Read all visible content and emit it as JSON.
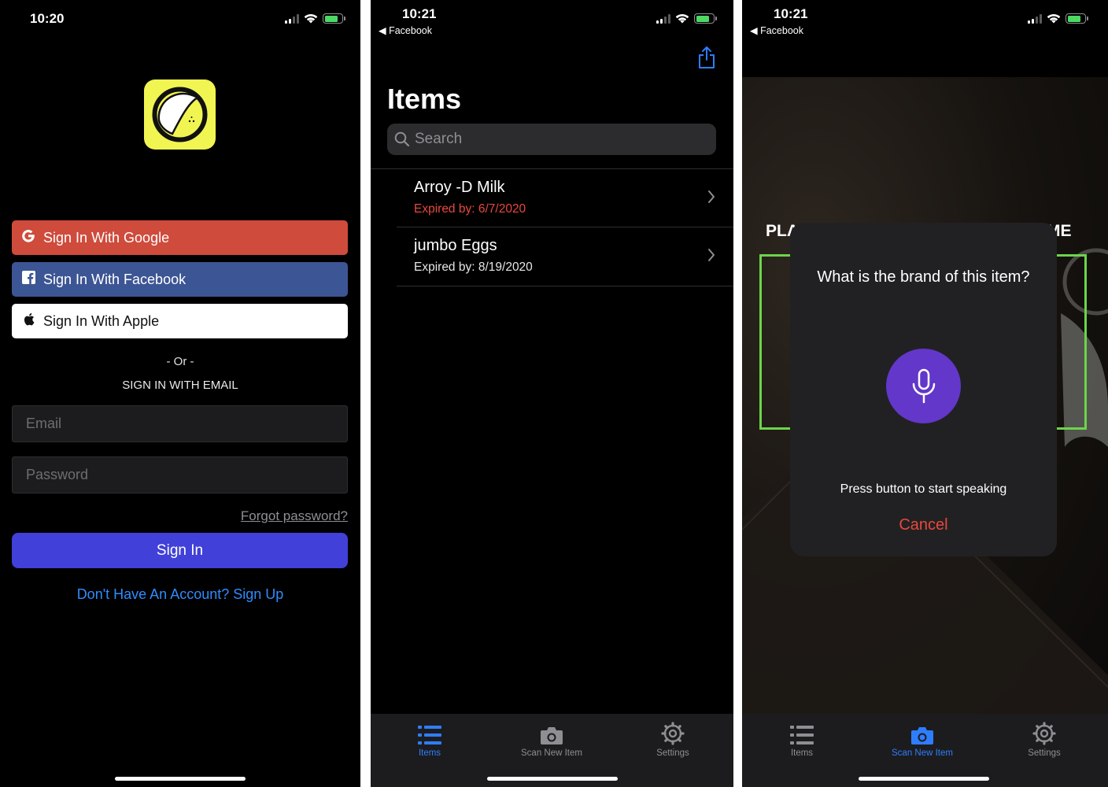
{
  "screen1": {
    "status_time": "10:20",
    "google_label": "Sign In With Google",
    "facebook_label": "Sign In With Facebook",
    "apple_label": "Sign In With Apple",
    "or_text": "- Or -",
    "email_heading": "SIGN IN WITH EMAIL",
    "email_placeholder": "Email",
    "password_placeholder": "Password",
    "forgot_label": "Forgot password?",
    "signin_label": "Sign In",
    "signup_label": "Don't Have An Account? Sign Up"
  },
  "screen2": {
    "status_time": "10:21",
    "back_label": "◀ Facebook",
    "title": "Items",
    "search_placeholder": "Search",
    "items": [
      {
        "name": "Arroy -D Milk",
        "expiry": "Expired by: 6/7/2020",
        "expired_color": "#e8483c"
      },
      {
        "name": "jumbo Eggs",
        "expiry": "Expired by: 8/19/2020",
        "expired_color": "#e6e6e6"
      }
    ],
    "tabs": [
      {
        "label": "Items",
        "icon": "list-icon"
      },
      {
        "label": "Scan New Item",
        "icon": "camera-icon"
      },
      {
        "label": "Settings",
        "icon": "gear-icon"
      }
    ],
    "active_tab": "Items"
  },
  "screen3": {
    "status_time": "10:21",
    "back_label": "◀ Facebook",
    "overlay_left": "PLA",
    "overlay_right": "ME",
    "question": "What is the brand of this item?",
    "press_text": "Press button to start speaking",
    "cancel_label": "Cancel",
    "tabs": [
      {
        "label": "Items",
        "icon": "list-icon"
      },
      {
        "label": "Scan New Item",
        "icon": "camera-icon"
      },
      {
        "label": "Settings",
        "icon": "gear-icon"
      }
    ],
    "active_tab": "Scan New Item"
  },
  "colors": {
    "google": "#cf4b3c",
    "facebook": "#3c5594",
    "primary": "#4140d9",
    "link": "#2f8cff",
    "danger": "#e8483c",
    "tab_active": "#2f7dff",
    "scan_frame": "#6cd54a",
    "mic": "#6237c9",
    "logo": "#f1f551"
  }
}
